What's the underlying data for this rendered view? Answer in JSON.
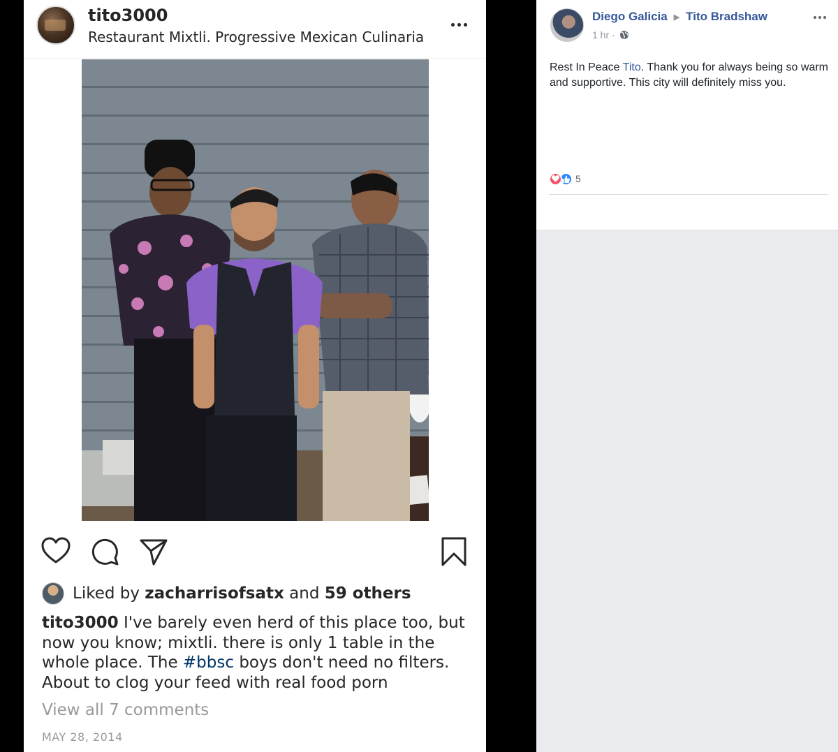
{
  "instagram": {
    "username": "tito3000",
    "location": "Restaurant Mixtli. Progressive Mexican Culinaria",
    "likes": {
      "prefix": "Liked by",
      "user": "zacharrisofsatx",
      "and": "and",
      "others": "59 others"
    },
    "caption": {
      "username": "tito3000",
      "text_before_tag": "I've barely even herd of this place too, but now you know; mixtli. there is only 1 table in the whole place. The",
      "hashtag": "#bbsc",
      "text_after_tag": "boys don't need no filters. About to clog your feed with real food porn"
    },
    "view_comments": "View all 7 comments",
    "date": "MAY 28, 2014",
    "icons": [
      "heart-icon",
      "comment-icon",
      "share-icon",
      "bookmark-icon",
      "more-icon"
    ]
  },
  "facebook": {
    "author": "Diego Galicia",
    "target": "Tito Bradshaw",
    "time": "1 hr",
    "separator": "·",
    "post_text_before": "Rest In Peace",
    "post_mention": "Tito",
    "post_text_after": ". Thank you for always being so warm and supportive. This city will definitely miss you.",
    "reactions_count": "5",
    "colors": {
      "link": "#365899",
      "love": "#f25268",
      "like": "#2d88ff"
    }
  }
}
